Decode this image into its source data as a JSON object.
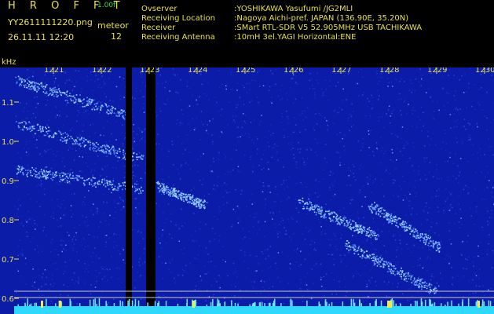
{
  "header": {
    "brand": "H R O F F T",
    "version": "1.00f",
    "filename": "YY2611111220.png",
    "timestamp": "26.11.11 12:20",
    "meteor_label": "meteor",
    "meteor_count": "12",
    "meta": [
      {
        "key": "Ovserver",
        "value": ":YOSHIKAWA Yasufumi /JG2MLI"
      },
      {
        "key": "Receiving Location",
        "value": ":Nagoya Aichi-pref. JAPAN (136.90E, 35.20N)"
      },
      {
        "key": "Receiver",
        "value": ":SMart RTL-SDR V5 52.905MHz USB TACHIKAWA"
      },
      {
        "key": "Receiving Antenna",
        "value": ":10mH 3el.YAGI Horizontal:ENE"
      }
    ]
  },
  "spectrogram": {
    "unit_label": "kHz",
    "time_ticks": [
      "1221",
      "1222",
      "1223",
      "1224",
      "1225",
      "1226",
      "1227",
      "1228",
      "1229",
      "1230"
    ],
    "freq_ticks": [
      "1.1",
      "1.0",
      "0.9",
      "0.8",
      "0.7",
      "0.6"
    ],
    "colors": {
      "background": "#0a1ca8",
      "signal": "#9fd8ff",
      "axis": "#e8e04a",
      "baseline": "#2fd8ff"
    }
  }
}
